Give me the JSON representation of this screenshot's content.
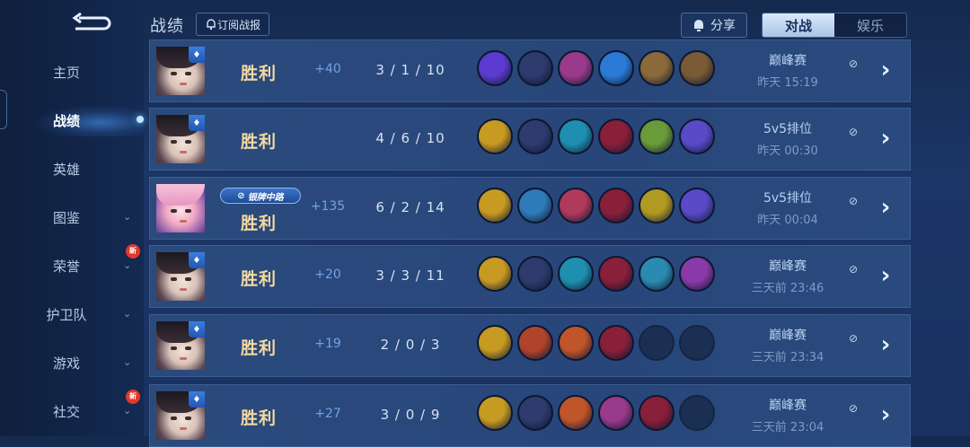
{
  "header": {
    "title": "战绩",
    "subscribe_label": "订阅战报",
    "share_label": "分享",
    "tabs": [
      {
        "label": "对战",
        "active": true
      },
      {
        "label": "娱乐",
        "active": false
      }
    ]
  },
  "sidebar": {
    "items": [
      {
        "label": "主页",
        "chevron": false,
        "active": false,
        "new": false
      },
      {
        "label": "战绩",
        "chevron": false,
        "active": true,
        "new": false
      },
      {
        "label": "英雄",
        "chevron": false,
        "active": false,
        "new": false
      },
      {
        "label": "图鉴",
        "chevron": true,
        "active": false,
        "new": false
      },
      {
        "label": "荣誉",
        "chevron": true,
        "active": false,
        "new": true
      },
      {
        "label": "护卫队",
        "chevron": true,
        "active": false,
        "new": false
      },
      {
        "label": "游戏",
        "chevron": true,
        "active": false,
        "new": false
      },
      {
        "label": "社交",
        "chevron": true,
        "active": false,
        "new": true
      }
    ],
    "new_badge": "新"
  },
  "matches": [
    {
      "result": "胜利",
      "points": "+40",
      "kda": "3 / 1 / 10",
      "mode": "巅峰赛",
      "time": "昨天 15:19",
      "portrait": "dark",
      "tag": "",
      "items": [
        "#5b3bd0",
        "#2d3b6e",
        "#9a3a8a",
        "#2b7ad8",
        "#8a6a3a",
        "#7a5a34"
      ]
    },
    {
      "result": "胜利",
      "points": "",
      "kda": "4 / 6 / 10",
      "mode": "5v5排位",
      "time": "昨天 00:30",
      "portrait": "dark",
      "tag": "",
      "items": [
        "#c79a22",
        "#2d3b6e",
        "#1f8fb0",
        "#8a1f3a",
        "#6a9a3a",
        "#5a4ac8"
      ]
    },
    {
      "result": "胜利",
      "points": "+135",
      "kda": "6 / 2 / 14",
      "mode": "5v5排位",
      "time": "昨天 00:04",
      "portrait": "pink",
      "tag": "银牌中路",
      "items": [
        "#c79a22",
        "#2f7ab8",
        "#b03a5a",
        "#8a1f3a",
        "#b09a22",
        "#5a4ac8"
      ]
    },
    {
      "result": "胜利",
      "points": "+20",
      "kda": "3 / 3 / 11",
      "mode": "巅峰赛",
      "time": "三天前 23:46",
      "portrait": "dark",
      "tag": "",
      "items": [
        "#c79a22",
        "#2d3b6e",
        "#1f8fb0",
        "#8a1f3a",
        "#2a8ab0",
        "#8a3aa8"
      ]
    },
    {
      "result": "胜利",
      "points": "+19",
      "kda": "2 / 0 / 3",
      "mode": "巅峰赛",
      "time": "三天前 23:34",
      "portrait": "dark",
      "tag": "",
      "items": [
        "#c79a22",
        "#b0442a",
        "#c0552a",
        "#8a1f3a",
        "",
        ""
      ]
    },
    {
      "result": "胜利",
      "points": "+27",
      "kda": "3 / 0 / 9",
      "mode": "巅峰赛",
      "time": "三天前 23:04",
      "portrait": "dark",
      "tag": "",
      "items": [
        "#c79a22",
        "#2d3b6e",
        "#c0552a",
        "#9a3a8a",
        "#8a1f3a",
        ""
      ]
    }
  ],
  "icons": {
    "back": "back-arrow-icon",
    "subscribe": "subscribe-bell-icon",
    "share": "share-icon",
    "detail": "data-detail-icon",
    "arrow": "chevron-right-icon",
    "rank": "rank-badge-icon"
  }
}
